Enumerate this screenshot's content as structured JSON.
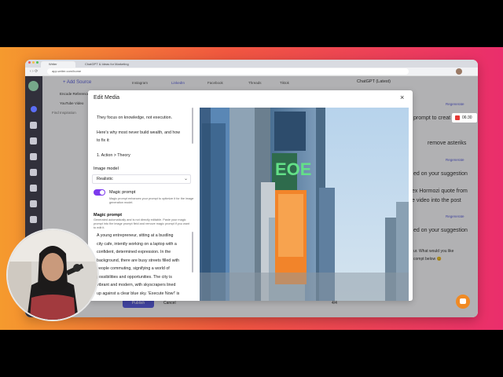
{
  "browser": {
    "tabs": [
      "Writer",
      "ChatGPT & Ideas for Marketing",
      ""
    ],
    "url": "app.writer.com/home"
  },
  "app_bg": {
    "add_source_label": "+ Add Source",
    "source_items": [
      "Encode Reference",
      "YouTube Video",
      "Find Inspiration"
    ],
    "top_tabs": [
      "Instagram",
      "LinkedIn",
      "Facebook",
      "Threads",
      "Tiktok"
    ],
    "model_select": "ChatGPT (Latest)",
    "chat_lines": [
      "Regenerate",
      "prompt to creat",
      "remove asteriks",
      "Regenerate",
      "ed on your suggestion",
      "ex Hormozi quote from",
      "e video into the post",
      "Regenerate",
      "ed on your suggestion",
      "ur. What would you like",
      "compt below 😊"
    ],
    "bottom_buttons": [
      "Publish",
      "Cancel"
    ],
    "page_indicator": "4/4"
  },
  "recorder": {
    "time": "06:30"
  },
  "modal": {
    "title": "Edit Media",
    "close_icon": "×",
    "caption_lines": [
      "They focus on knowledge, not execution.",
      "Here's why most never build wealth, and how",
      "to fix it:",
      "1. Action > Theory"
    ],
    "image_model_label": "Image model",
    "image_model_value": "Realistic",
    "magic_prompt_label": "Magic prompt",
    "magic_prompt_enabled": true,
    "magic_prompt_help": "Magic prompt enhances your prompt to optimize it for the image generation model.",
    "magic_prompt_heading": "Magic prompt",
    "magic_prompt_note": "Generated automatically and is not directly editable. Paste your magic prompt into the image prompt field and remove magic prompt if you want to edit it.",
    "magic_prompt_lines": [
      "A young entrepreneur, sitting at a bustling",
      "city cafe, intently working on a laptop with a",
      "confident, determined expression. In the",
      "background, there are busy streets filled with",
      "people commuting, signifying a world of",
      "possibilities and opportunities. The city is",
      "vibrant and modern, with skyscrapers lined",
      "up against a clear blue sky. 'Execute Now!' is"
    ],
    "image_sign_text": "EOE",
    "colors": {
      "accent": "#7c3aed",
      "sky": "#a9c9e6"
    }
  }
}
